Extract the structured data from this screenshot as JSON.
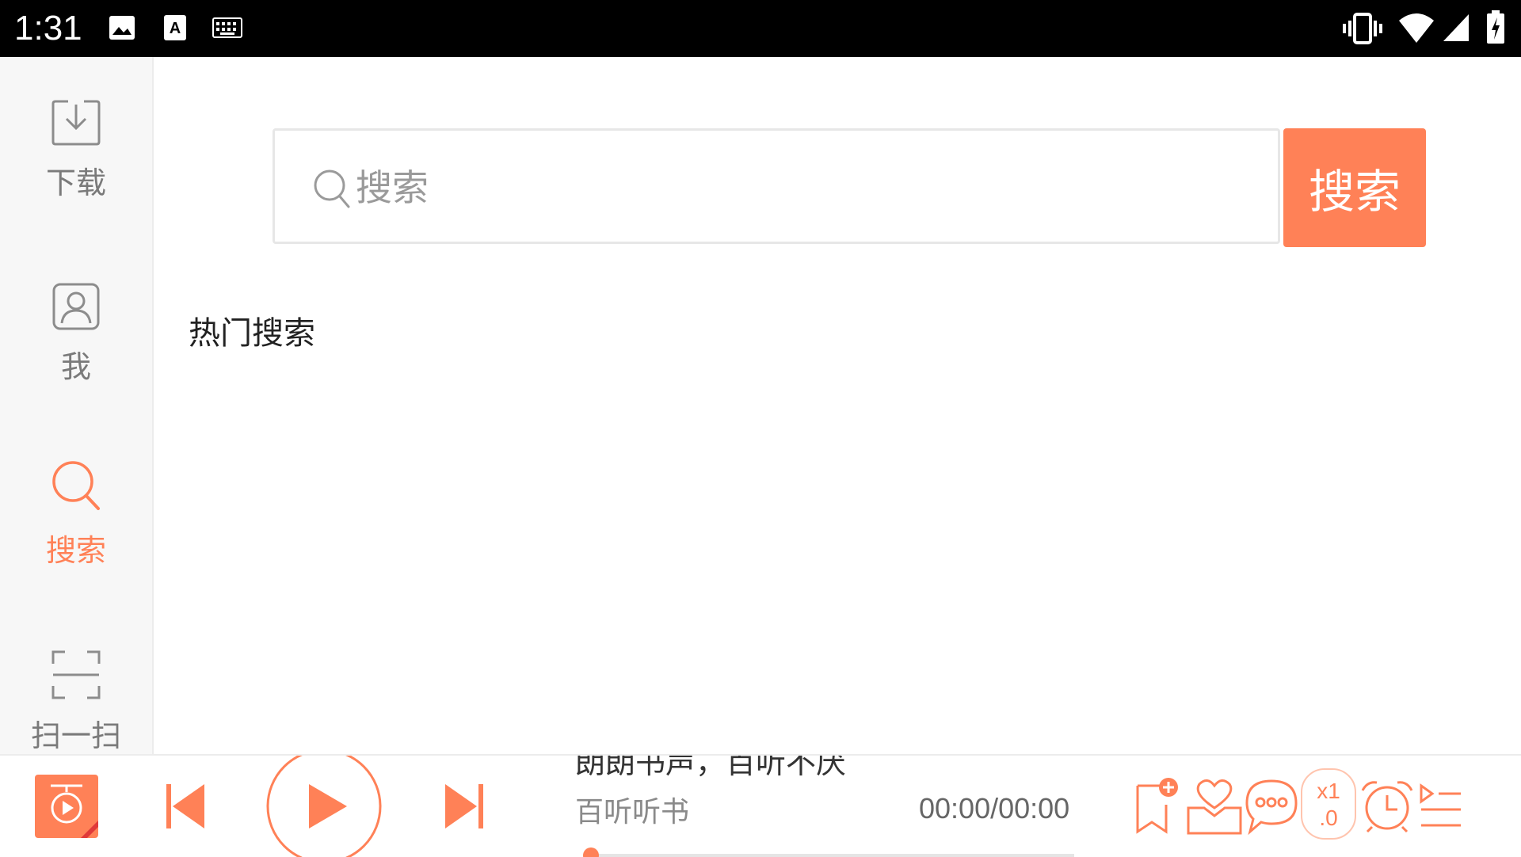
{
  "status_bar": {
    "time": "1:31"
  },
  "sidebar": {
    "items": [
      {
        "label": "下载",
        "icon": "download-icon",
        "active": false
      },
      {
        "label": "我",
        "icon": "user-icon",
        "active": false
      },
      {
        "label": "搜索",
        "icon": "search-icon",
        "active": true
      },
      {
        "label": "扫一扫",
        "icon": "scan-icon",
        "active": false
      }
    ]
  },
  "search": {
    "placeholder": "搜索",
    "button_label": "搜索"
  },
  "hot_search": {
    "title": "热门搜索"
  },
  "player": {
    "title": "朗朗书声，百听不厌",
    "subtitle": "百听听书",
    "time": "00:00/00:00",
    "speed_line1": "x1",
    "speed_line2": ".0",
    "progress": 0
  },
  "colors": {
    "accent": "#ff8157",
    "sidebar_bg": "#f7f7f7",
    "status_bar": "#000000"
  }
}
